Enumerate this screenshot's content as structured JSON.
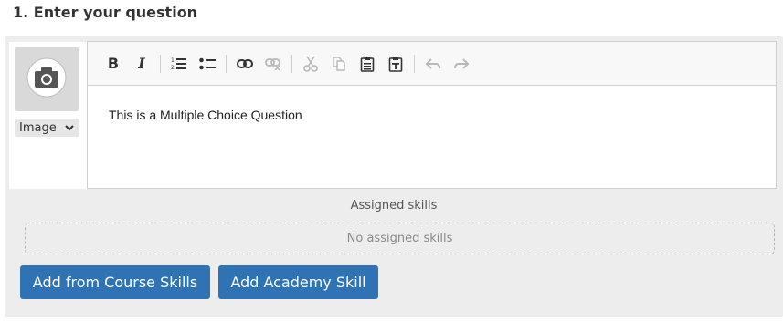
{
  "section": {
    "title": "1. Enter your question"
  },
  "image_picker": {
    "icon": "camera-icon",
    "select_label": "Image"
  },
  "toolbar": {
    "buttons": [
      {
        "name": "bold",
        "label": "B"
      },
      {
        "name": "italic",
        "label": "I"
      },
      {
        "name": "numbered-list",
        "icon": "numbered-list-icon"
      },
      {
        "name": "bulleted-list",
        "icon": "bulleted-list-icon"
      },
      {
        "name": "link",
        "icon": "link-icon"
      },
      {
        "name": "unlink",
        "icon": "unlink-icon"
      },
      {
        "name": "cut",
        "icon": "scissors-icon"
      },
      {
        "name": "copy",
        "icon": "copy-icon"
      },
      {
        "name": "paste",
        "icon": "clipboard-icon"
      },
      {
        "name": "paste-text",
        "icon": "clipboard-text-icon"
      },
      {
        "name": "undo",
        "icon": "undo-icon"
      },
      {
        "name": "redo",
        "icon": "redo-icon"
      }
    ]
  },
  "editor": {
    "content": "This is a Multiple Choice Question"
  },
  "skills": {
    "label": "Assigned skills",
    "empty_text": "No assigned skills"
  },
  "actions": {
    "add_course_skills": "Add from Course Skills",
    "add_academy_skill": "Add Academy Skill"
  },
  "colors": {
    "primary_button": "#2f73b5",
    "panel_bg": "#ededed",
    "disabled_icon": "#b8b8b8"
  }
}
